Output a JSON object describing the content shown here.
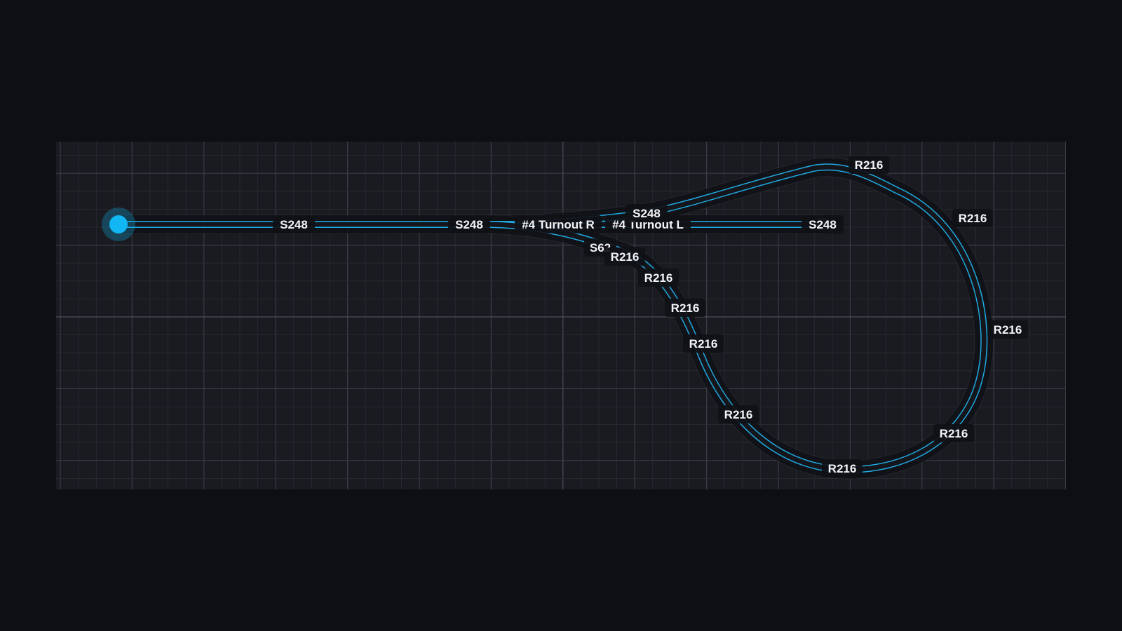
{
  "canvas": {
    "background": "#1a1b21",
    "grid_minor_color": "#2a2c33",
    "grid_major_color": "#3a3c44",
    "grid_axis_color": "#4c4f57"
  },
  "track": {
    "rail_color": "#1fa8e0",
    "bed_color": "#0b0c10",
    "bed_edge_color": "#3a3d45",
    "start_node_color": "#12b6f3",
    "end_node_color": "#4a4d55",
    "pieces": [
      {
        "id": "s248-a",
        "label": "S248"
      },
      {
        "id": "s248-b",
        "label": "S248"
      },
      {
        "id": "turnout-r",
        "label": "#4 Turnout R"
      },
      {
        "id": "turnout-l",
        "label": "#4 Turnout L"
      },
      {
        "id": "s248-c",
        "label": "S248"
      },
      {
        "id": "s248-d",
        "label": "S248"
      },
      {
        "id": "s62",
        "label": "S62"
      },
      {
        "id": "r216-1",
        "label": "R216"
      },
      {
        "id": "r216-2",
        "label": "R216"
      },
      {
        "id": "r216-3",
        "label": "R216"
      },
      {
        "id": "r216-4",
        "label": "R216"
      },
      {
        "id": "r216-5",
        "label": "R216"
      },
      {
        "id": "r216-6",
        "label": "R216"
      },
      {
        "id": "r216-7",
        "label": "R216"
      },
      {
        "id": "r216-8",
        "label": "R216"
      },
      {
        "id": "r216-9",
        "label": "R216"
      },
      {
        "id": "r216-10",
        "label": "R216"
      }
    ]
  }
}
